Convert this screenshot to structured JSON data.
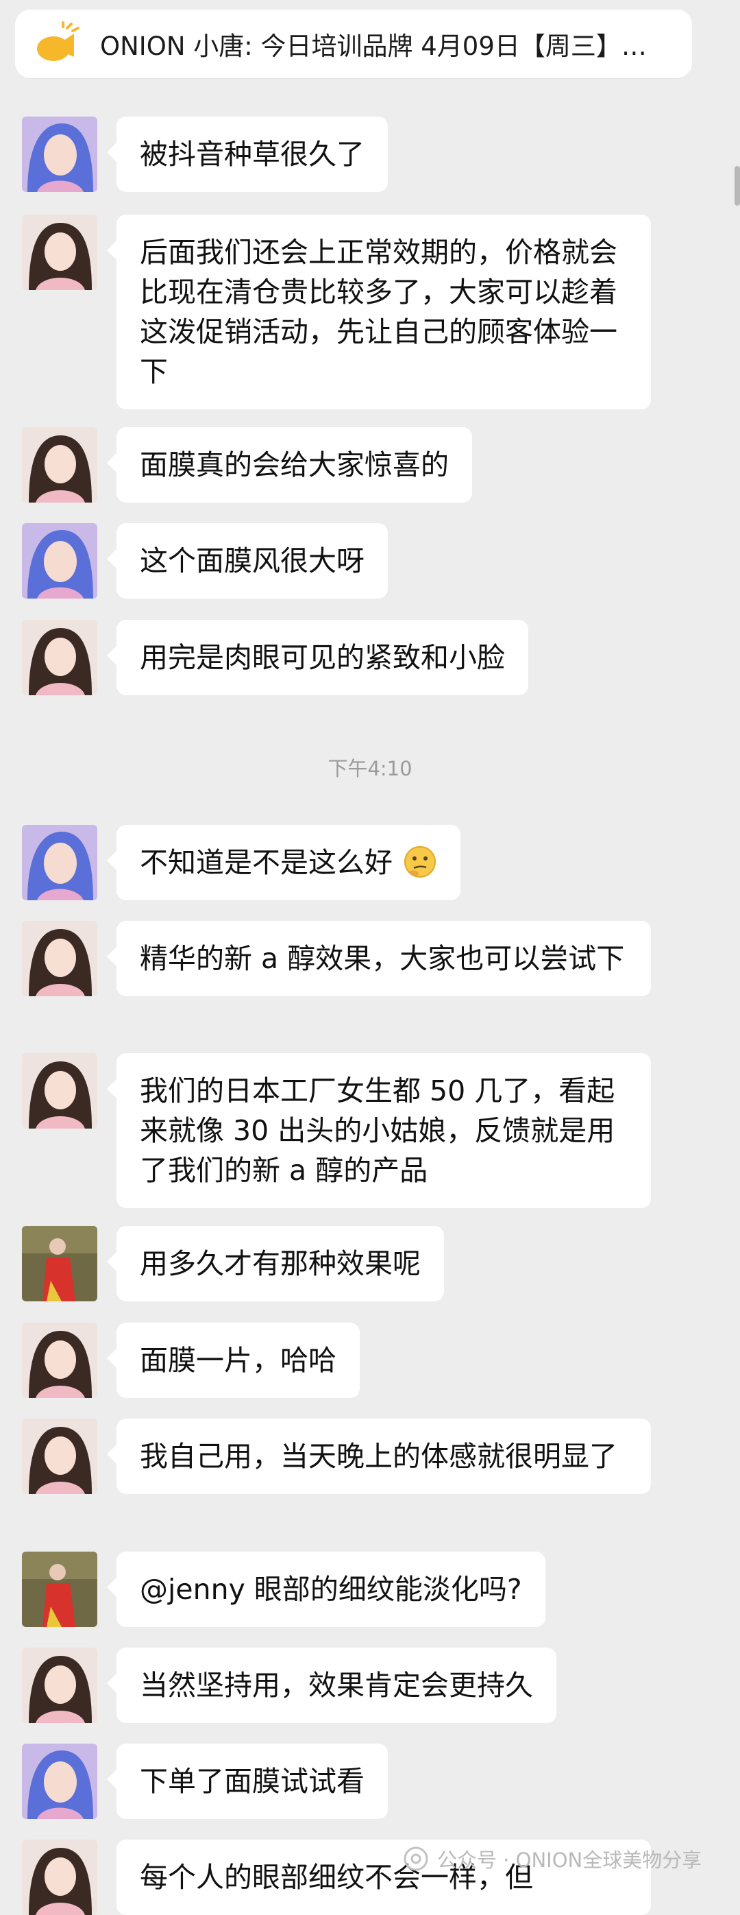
{
  "pinned": {
    "text": "ONION 小唐: 今日培训品牌 4月09日【周三】👇…"
  },
  "messages": [
    {
      "sender": "blue",
      "text": "被抖音种草很久了"
    },
    {
      "sender": "pink",
      "text": "后面我们还会上正常效期的，价格就会比现在清仓贵比较多了，大家可以趁着这泼促销活动，先让自己的顾客体验一下"
    },
    {
      "sender": "pink",
      "text": "面膜真的会给大家惊喜的"
    },
    {
      "sender": "blue",
      "text": "这个面膜风很大呀"
    },
    {
      "sender": "pink",
      "text": "用完是肉眼可见的紧致和小脸"
    },
    {
      "sender": "blue",
      "text": "不知道是不是这么好"
    },
    {
      "sender": "pink",
      "text": "精华的新 a 醇效果，大家也可以尝试下"
    },
    {
      "sender": "pink",
      "text": "我们的日本工厂女生都 50 几了，看起来就像 30 出头的小姑娘，反馈就是用了我们的新 a 醇的产品"
    },
    {
      "sender": "red",
      "text": "用多久才有那种效果呢"
    },
    {
      "sender": "pink",
      "text": "面膜一片，哈哈"
    },
    {
      "sender": "pink",
      "text": "我自己用，当天晚上的体感就很明显了"
    },
    {
      "sender": "red",
      "text": "@jenny  眼部的细纹能淡化吗?"
    },
    {
      "sender": "pink",
      "text": "当然坚持用，效果肯定会更持久"
    },
    {
      "sender": "blue",
      "text": "下单了面膜试试看"
    },
    {
      "sender": "pink",
      "text": "每个人的眼部细纹不会一样，但"
    }
  ],
  "timestamp": "下午4:10",
  "watermark": "公众号 · ONION全球美物分享",
  "colors": {
    "background": "#ededed",
    "bubble": "#ffffff",
    "timestamp": "#9b9b9b"
  }
}
